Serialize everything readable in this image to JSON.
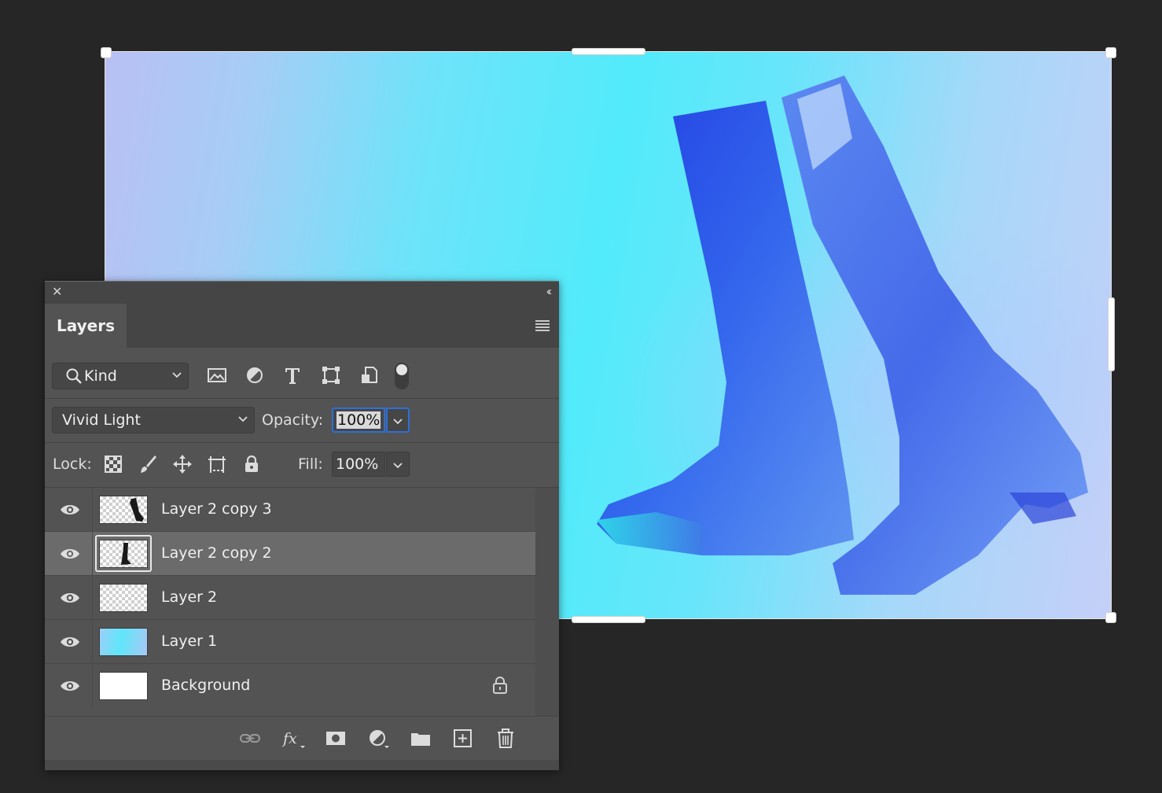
{
  "document": {
    "canvas_image": "boots-photo-blue-cyan-grain"
  },
  "panel": {
    "title": "Layers",
    "close_icon": "close-icon",
    "collapse_icon": "collapse-double-chevron-icon",
    "menu_icon": "panel-menu-icon"
  },
  "filter": {
    "kind_label": "Kind",
    "icons": [
      "image-filter-icon",
      "adjustment-filter-icon",
      "type-filter-icon",
      "shape-filter-icon",
      "smart-object-filter-icon",
      "filter-toggle-icon"
    ]
  },
  "blend": {
    "mode": "Vivid Light",
    "opacity_label": "Opacity:",
    "opacity_value": "100%",
    "fill_label": "Fill:",
    "fill_value": "100%"
  },
  "lock": {
    "label": "Lock:",
    "icons": [
      "lock-transparent-pixels-icon",
      "lock-image-pixels-icon",
      "lock-position-icon",
      "lock-artboard-icon",
      "lock-all-icon"
    ]
  },
  "layers": [
    {
      "name": "Layer 2 copy 3",
      "visible": true,
      "selected": false,
      "thumb": "boot-side"
    },
    {
      "name": "Layer 2 copy 2",
      "visible": true,
      "selected": true,
      "thumb": "boot-front"
    },
    {
      "name": "Layer 2",
      "visible": true,
      "selected": false,
      "thumb": "transparent"
    },
    {
      "name": "Layer 1",
      "visible": true,
      "selected": false,
      "thumb": "gradient"
    },
    {
      "name": "Background",
      "visible": true,
      "selected": false,
      "thumb": "white",
      "locked": true
    }
  ],
  "footer_icons": [
    "link-layers-icon",
    "fx-icon",
    "add-mask-icon",
    "new-adjustment-layer-icon",
    "new-group-icon",
    "new-layer-icon",
    "delete-layer-icon"
  ],
  "colors": {
    "app_bg": "#262626",
    "panel_bg": "#535353",
    "selected_row": "#6b6b6b",
    "accent_focus": "#2f6fd6"
  }
}
